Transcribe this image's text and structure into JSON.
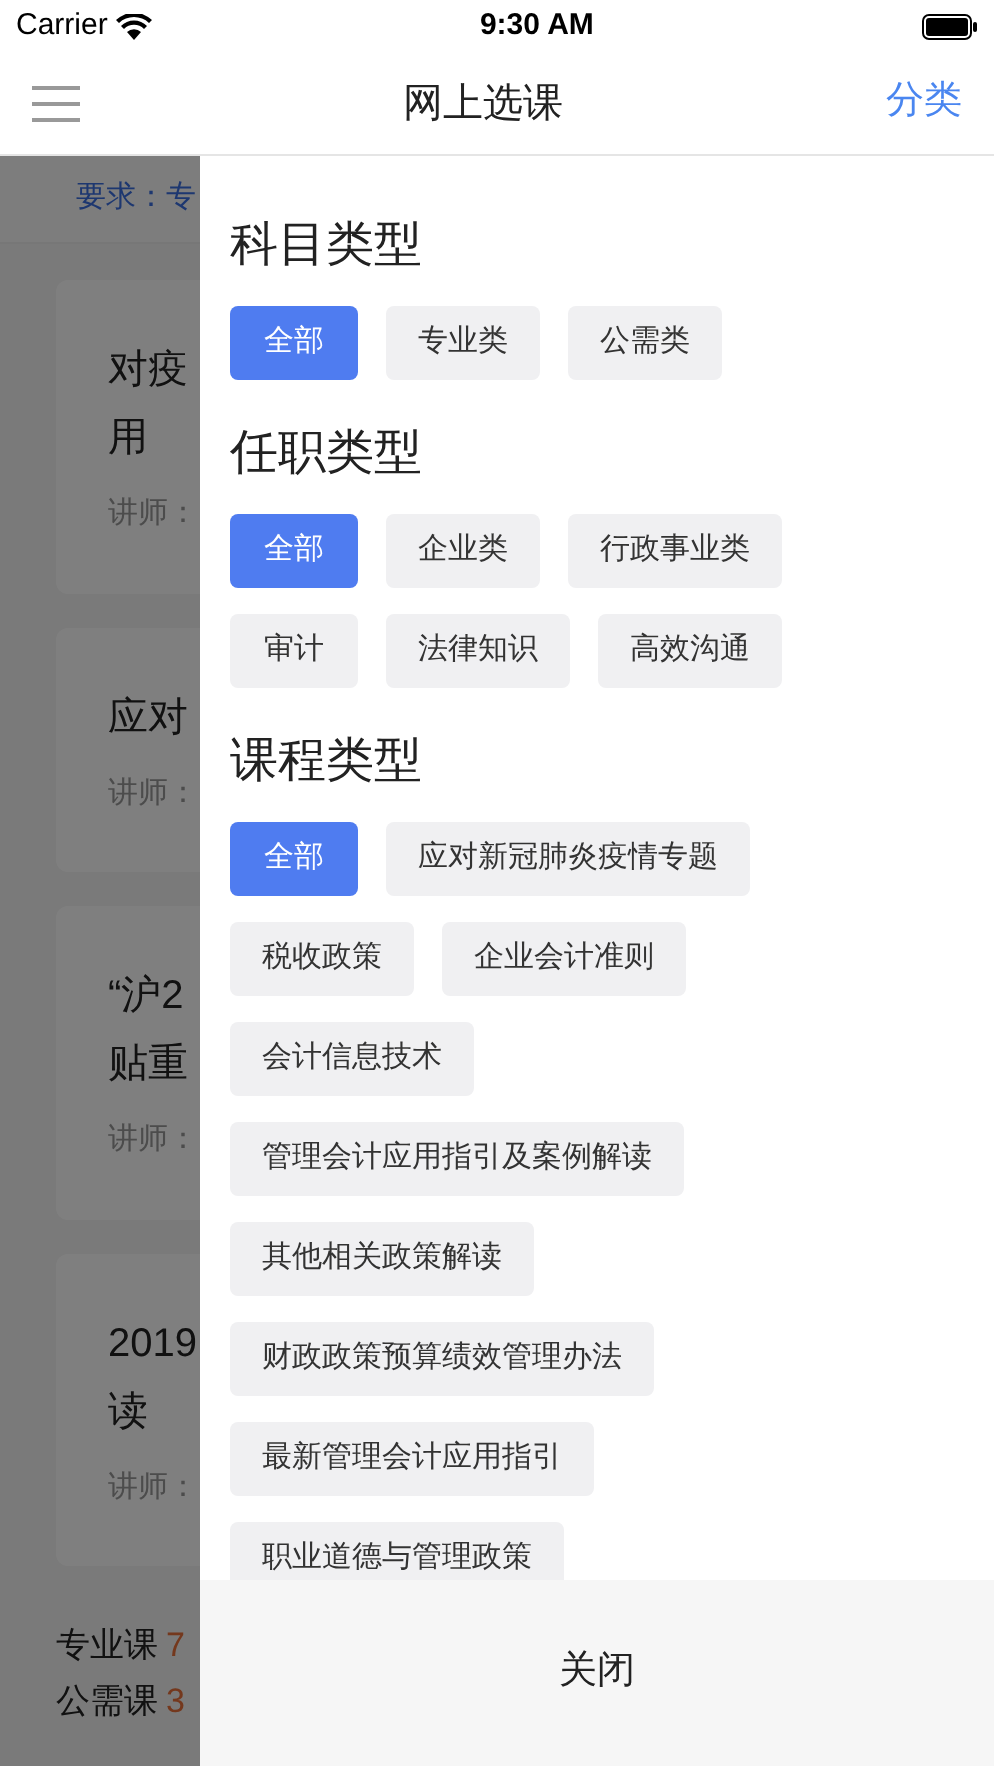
{
  "status_bar": {
    "carrier": "Carrier",
    "time": "9:30 AM"
  },
  "nav_bar": {
    "title": "网上选课",
    "action": "分类"
  },
  "background": {
    "requirement": "要求：专",
    "cards": [
      {
        "title_lines": [
          "对疫",
          "用"
        ],
        "lecturer": "讲师："
      },
      {
        "title_lines": [
          "应对"
        ],
        "lecturer": "讲师："
      },
      {
        "title_lines": [
          "“沪2",
          "贴重"
        ],
        "lecturer": "讲师："
      },
      {
        "title_lines": [
          "2019",
          "读"
        ],
        "lecturer": "讲师："
      }
    ],
    "footer": [
      {
        "label": "专业课",
        "value": "7"
      },
      {
        "label": "公需课",
        "value": "3"
      }
    ]
  },
  "filter_panel": {
    "sections": [
      {
        "title": "科目类型",
        "options": [
          {
            "label": "全部",
            "selected": true
          },
          {
            "label": "专业类",
            "selected": false
          },
          {
            "label": "公需类",
            "selected": false
          }
        ]
      },
      {
        "title": "任职类型",
        "options": [
          {
            "label": "全部",
            "selected": true
          },
          {
            "label": "企业类",
            "selected": false
          },
          {
            "label": "行政事业类",
            "selected": false
          },
          {
            "label": "审计",
            "selected": false
          },
          {
            "label": "法律知识",
            "selected": false
          },
          {
            "label": "高效沟通",
            "selected": false
          }
        ]
      },
      {
        "title": "课程类型",
        "options": [
          {
            "label": "全部",
            "selected": true
          },
          {
            "label": "应对新冠肺炎疫情专题",
            "selected": false
          },
          {
            "label": "税收政策",
            "selected": false
          },
          {
            "label": "企业会计准则",
            "selected": false
          },
          {
            "label": "会计信息技术",
            "selected": false
          },
          {
            "label": "管理会计应用指引及案例解读",
            "selected": false
          },
          {
            "label": "其他相关政策解读",
            "selected": false
          },
          {
            "label": "财政政策预算绩效管理办法",
            "selected": false
          },
          {
            "label": "最新管理会计应用指引",
            "selected": false
          },
          {
            "label": "职业道德与管理政策",
            "selected": false
          }
        ]
      }
    ],
    "close_button": "关闭"
  }
}
